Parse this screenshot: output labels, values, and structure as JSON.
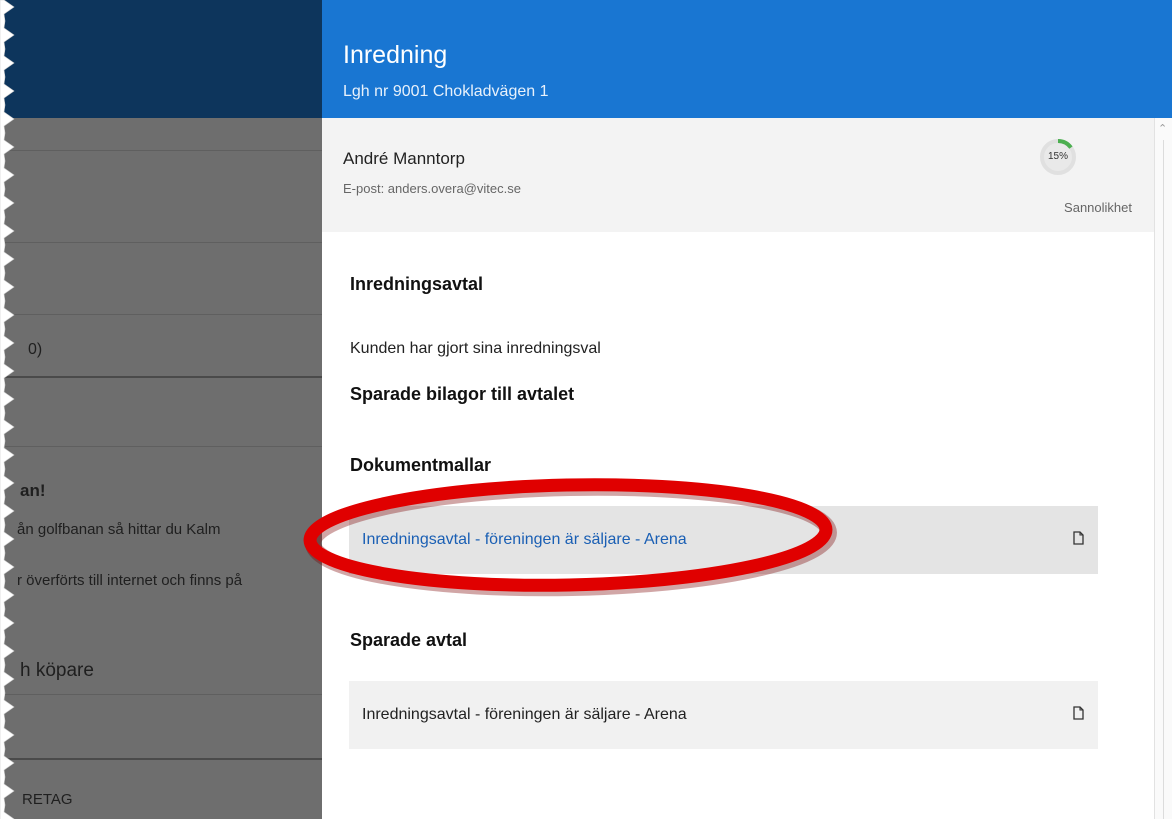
{
  "background": {
    "items": [
      {
        "text": "0)",
        "style": "normal"
      },
      {
        "text": "an!",
        "style": "bold"
      },
      {
        "text": "ån golfbanan så hittar du Kalm",
        "style": "small"
      },
      {
        "text": "r överförts till internet och finns på",
        "style": "small"
      },
      {
        "text": "h köpare",
        "style": "head"
      },
      {
        "text": "RETAG",
        "style": "small"
      }
    ]
  },
  "panel": {
    "title": "Inredning",
    "subtitle": "Lgh nr 9001 Chokladvägen 1",
    "contact": {
      "name": "André Manntorp",
      "email": "E-post: anders.overa@vitec.se",
      "probability_value": "15%",
      "probability_fraction": 0.15,
      "probability_label": "Sannolikhet"
    },
    "sections": {
      "agreement_heading": "Inredningsavtal",
      "agreement_status": "Kunden har gjort sina inredningsval",
      "saved_attachments_heading": "Sparade bilagor till avtalet",
      "templates_heading": "Dokumentmallar",
      "templates": [
        {
          "label": "Inredningsavtal - föreningen är säljare - Arena"
        }
      ],
      "saved_agreements_heading": "Sparade avtal",
      "saved_agreements": [
        {
          "label": "Inredningsavtal - föreningen är säljare - Arena"
        }
      ]
    }
  },
  "icons": {
    "document": "document-icon",
    "scroll_up": "chevron-up-icon"
  },
  "colors": {
    "header_blue": "#1976d2",
    "dark_navy": "#0d355c",
    "link_blue": "#1a5fb4",
    "gauge_green": "#4caf50",
    "annotation_red": "#e00000"
  }
}
